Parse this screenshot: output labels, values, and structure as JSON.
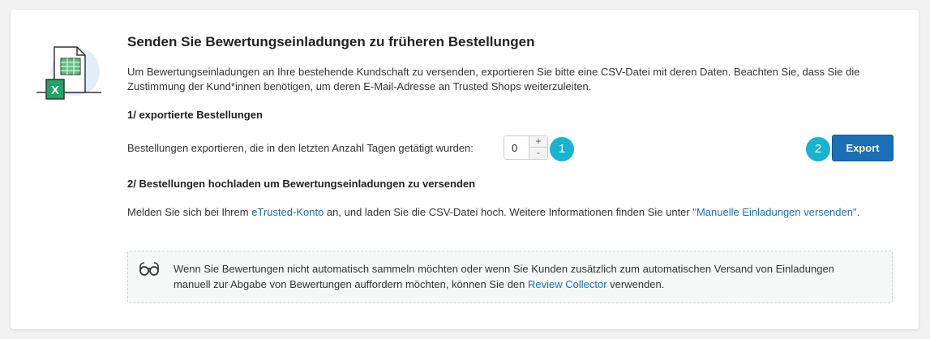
{
  "title": "Senden Sie Bewertungseinladungen zu früheren Bestellungen",
  "intro": "Um Bewertungseinladungen an Ihre bestehende Kundschaft zu versenden, exportieren Sie bitte eine CSV-Datei mit deren Daten. Beachten Sie, dass Sie die Zustimmung der Kund*innen benötigen, um deren E-Mail-Adresse an Trusted Shops weiterzuleiten.",
  "step1": {
    "heading": "1/ exportierte Bestellungen",
    "label": "Bestellungen exportieren, die in den letzten Anzahl Tagen getätigt wurden:",
    "days_value": "0",
    "plus": "+",
    "minus": "-",
    "badge": "1"
  },
  "export": {
    "badge": "2",
    "button_label": "Export"
  },
  "step2": {
    "heading": "2/ Bestellungen hochladen um Bewertungseinladungen zu versenden",
    "text_before": "Melden Sie sich bei Ihrem ",
    "link1": "eTrusted-Konto",
    "text_middle": " an, und laden Sie die CSV-Datei hoch. Weitere Informationen finden Sie unter ",
    "link2": "\"Manuelle Einladungen versenden\"",
    "text_after": "."
  },
  "info": {
    "icon": "glasses-icon",
    "text_before": "Wenn Sie Bewertungen nicht automatisch sammeln möchten oder wenn Sie Kunden zusätzlich zum automatischen Versand von Einladungen manuell zur Abgabe von Bewertungen auffordern möchten, können Sie den ",
    "link": "Review Collector",
    "text_after": " verwenden."
  },
  "colors": {
    "accent": "#1b6fb5",
    "badge": "#17b3cf",
    "excel_green": "#21a366"
  }
}
